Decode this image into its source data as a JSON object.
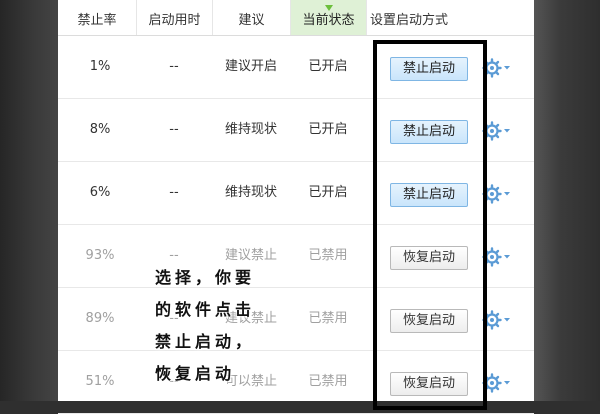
{
  "table": {
    "headers": [
      {
        "label": "禁止率"
      },
      {
        "label": "启动用时"
      },
      {
        "label": "建议"
      },
      {
        "label": "当前状态"
      },
      {
        "label": "设置启动方式"
      }
    ],
    "rows": [
      {
        "rate": "1%",
        "time": "--",
        "advice": "建议开启",
        "status": "已开启",
        "action": "禁止启动"
      },
      {
        "rate": "8%",
        "time": "--",
        "advice": "维持现状",
        "status": "已开启",
        "action": "禁止启动"
      },
      {
        "rate": "6%",
        "time": "--",
        "advice": "维持现状",
        "status": "已开启",
        "action": "禁止启动"
      },
      {
        "rate": "93%",
        "time": "--",
        "advice": "建议禁止",
        "status": "已禁用",
        "action": "恢复启动"
      },
      {
        "rate": "89%",
        "time": "--",
        "advice": "建议禁止",
        "status": "已禁用",
        "action": "恢复启动"
      },
      {
        "rate": "51%",
        "time": "--",
        "advice": "可以禁止",
        "status": "已禁用",
        "action": "恢复启动"
      }
    ]
  },
  "annotation": {
    "lines": [
      "选择，你要",
      "的软件点击",
      "禁止启动，",
      "恢复启动"
    ]
  },
  "colors": {
    "active_header_bg": "#dff1d6",
    "active_indicator": "#6cbf3c",
    "button_blue_border": "#7fb6e4",
    "gear_blue": "#5b9bd5",
    "highlight_border": "#000000"
  },
  "icons": {
    "settings": "gear-icon",
    "dropdown": "chevron-down-icon",
    "sort_indicator": "triangle-down-icon"
  }
}
